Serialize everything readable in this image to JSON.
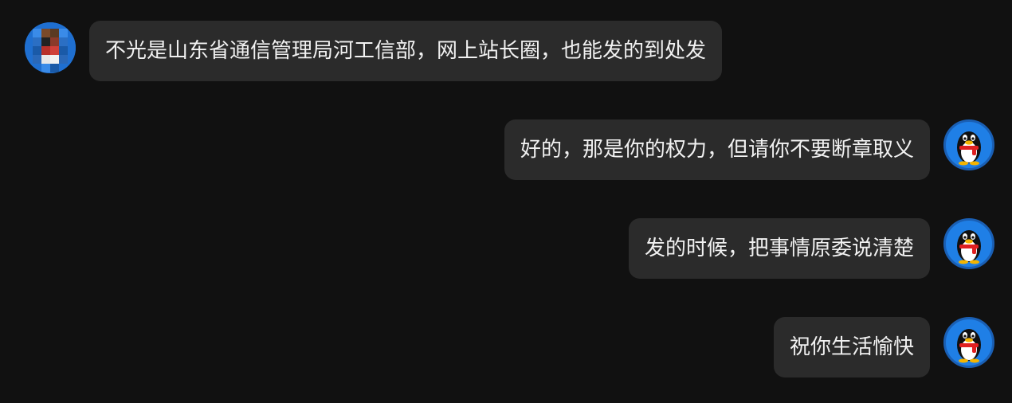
{
  "conversation": {
    "messages": [
      {
        "sender": "other",
        "avatar": "pixelated-avatar",
        "text": "不光是山东省通信管理局河工信部，网上站长圈，也能发的到处发"
      },
      {
        "sender": "self",
        "avatar": "qq-penguin-avatar",
        "text": "好的，那是你的权力，但请你不要断章取义"
      },
      {
        "sender": "self",
        "avatar": "qq-penguin-avatar",
        "text": "发的时候，把事情原委说清楚"
      },
      {
        "sender": "self",
        "avatar": "qq-penguin-avatar",
        "text": "祝你生活愉快"
      }
    ]
  },
  "colors": {
    "background": "#111111",
    "bubble": "#2b2b2b",
    "text": "#f1f1f1",
    "avatar_blue": "#1f7fe6"
  }
}
